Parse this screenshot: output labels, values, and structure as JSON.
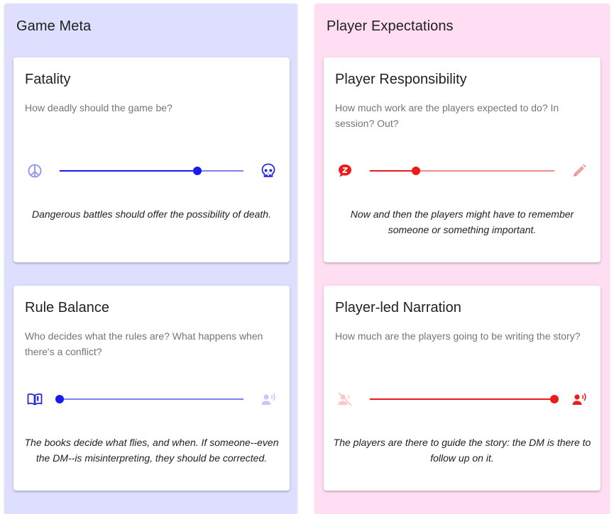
{
  "theme": {
    "blue": "#1a1aee",
    "blue_light": "#8080ee",
    "blue_faint": "#c6c6ff",
    "red": "#ee1a1a",
    "red_light": "#f08a8a",
    "red_faint": "#ffc6c6",
    "left_panel_bg": "#dedeff",
    "right_panel_bg": "#ffdef4"
  },
  "columns": [
    {
      "title": "Game Meta",
      "cards": [
        {
          "title": "Fatality",
          "description": "How deadly should the game be?",
          "left_icon": "peace-icon",
          "right_icon": "skull-icon",
          "slider_value_fraction": 0.75,
          "caption": "Dangerous battles should offer the possibility of death."
        },
        {
          "title": "Rule Balance",
          "description": "Who decides what the rules are? What happens when there's a conflict?",
          "left_icon": "book-icon",
          "right_icon": "person-speaking-icon",
          "slider_value_fraction": 0.0,
          "caption": "The books decide what flies, and when. If someone--even the DM--is misinterpreting, they should be corrected."
        }
      ]
    },
    {
      "title": "Player Expectations",
      "cards": [
        {
          "title": "Player Responsibility",
          "description": "How much work are the players expected to do? In session? Out?",
          "left_icon": "sleep-chat-icon",
          "right_icon": "pencil-icon",
          "slider_value_fraction": 0.25,
          "caption": "Now and then the players might have to remember someone or something important."
        },
        {
          "title": "Player-led Narration",
          "description": "How much are the players going to be writing the story?",
          "left_icon": "voice-off-icon",
          "right_icon": "person-speaking-icon",
          "slider_value_fraction": 1.0,
          "caption": "The players are there to guide the story: the DM is there to follow up on it."
        }
      ]
    }
  ]
}
